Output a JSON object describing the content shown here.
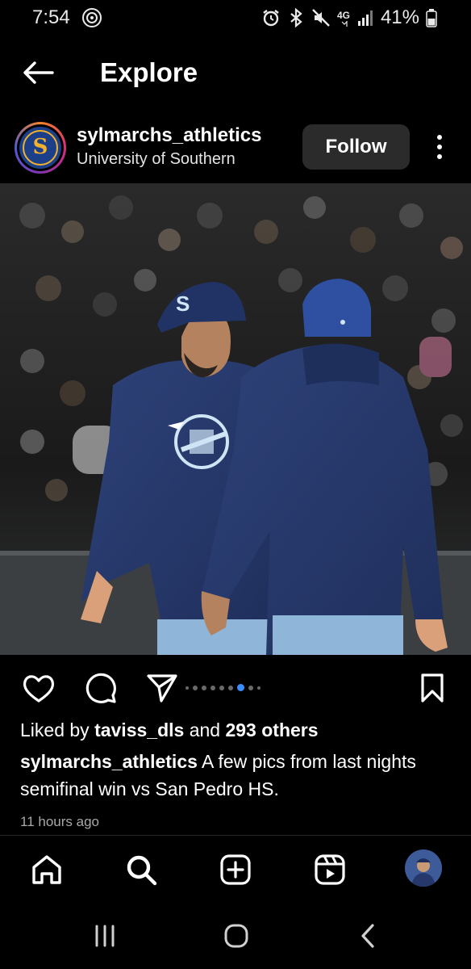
{
  "status_bar": {
    "time": "7:54",
    "battery": "41%",
    "network": "4G",
    "icons": [
      "alarm-icon",
      "bluetooth-icon",
      "mute-icon",
      "signal-icon",
      "battery-icon"
    ]
  },
  "header": {
    "title": "Explore",
    "back_icon": "arrow-left-icon"
  },
  "post": {
    "username": "sylmarchs_athletics",
    "subtitle": "University of Southern",
    "follow_label": "Follow",
    "avatar_letter": "S",
    "carousel": {
      "total": 10,
      "active": 7
    },
    "likes": {
      "prefix": "Liked by ",
      "user": "taviss_dls",
      "middle": " and ",
      "others": "293 others"
    },
    "caption": {
      "user": "sylmarchs_athletics",
      "text": " A few pics from last nights semifinal win vs San Pedro HS."
    },
    "time_ago": "11 hours ago"
  },
  "bottom_nav": [
    "home-icon",
    "search-icon",
    "create-icon",
    "reels-icon",
    "profile-avatar"
  ],
  "colors": {
    "background": "#000000",
    "follow_button": "#2b2b2b",
    "carousel_active": "#3b8cff",
    "uniform_navy": "#26386b"
  }
}
